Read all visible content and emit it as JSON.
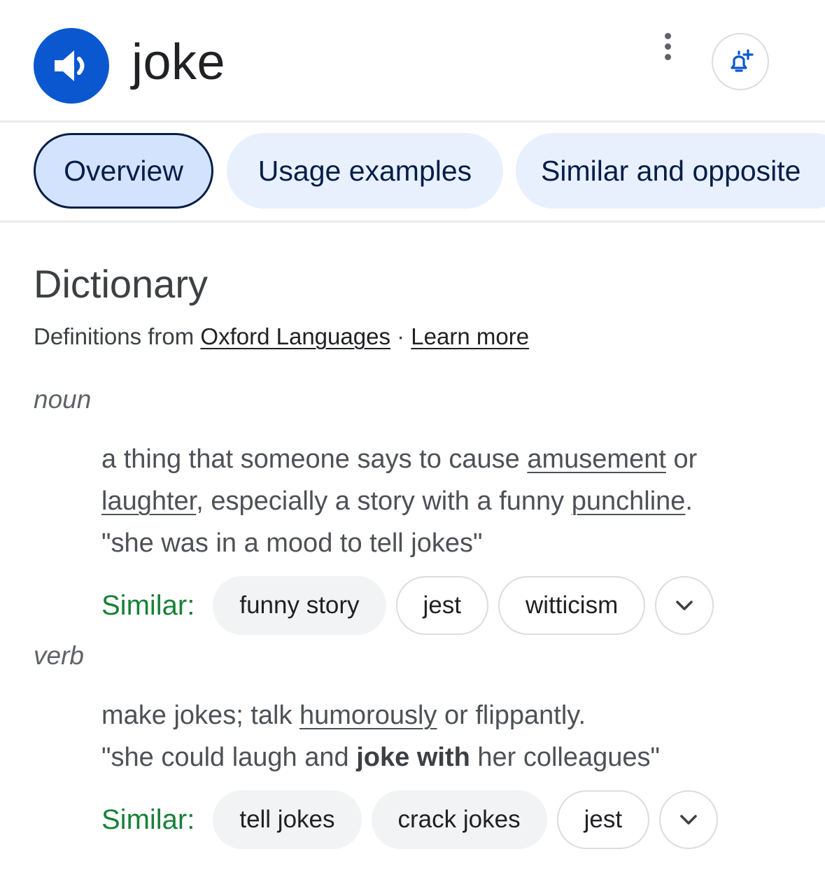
{
  "header": {
    "word": "joke",
    "speaker_icon": "volume-speaker-icon",
    "more_icon": "more-vert-icon",
    "alert_icon": "add-alert-bell-icon",
    "accent_color": "#0b57d0"
  },
  "tabs": [
    {
      "label": "Overview",
      "active": true
    },
    {
      "label": "Usage examples",
      "active": false
    },
    {
      "label": "Similar and opposite",
      "active": false
    }
  ],
  "dictionary": {
    "title": "Dictionary",
    "source_prefix": "Definitions from",
    "source_link": "Oxford Languages",
    "separator": "·",
    "learn_more": "Learn more"
  },
  "noun": {
    "pos": "noun",
    "definition": {
      "p1": "a thing that someone says to cause ",
      "link1": "amusement",
      "p2": " or ",
      "link2": "laughter",
      "p3": ", especially a story with a funny ",
      "link3": "punchline",
      "p4": "."
    },
    "example": "\"she was in a mood to tell jokes\"",
    "similar_label": "Similar:",
    "similar": [
      "funny story",
      "jest",
      "witticism"
    ],
    "expand_icon": "chevron-down-icon"
  },
  "verb": {
    "pos": "verb",
    "definition": {
      "p1": "make jokes; talk ",
      "link1": "humorously",
      "p2": " or flippantly."
    },
    "example": {
      "p1": "\"she could laugh and ",
      "bold": "joke with",
      "p2": " her colleagues\""
    },
    "similar_label": "Similar:",
    "similar": [
      "tell jokes",
      "crack jokes",
      "jest"
    ],
    "expand_icon": "chevron-down-icon"
  }
}
